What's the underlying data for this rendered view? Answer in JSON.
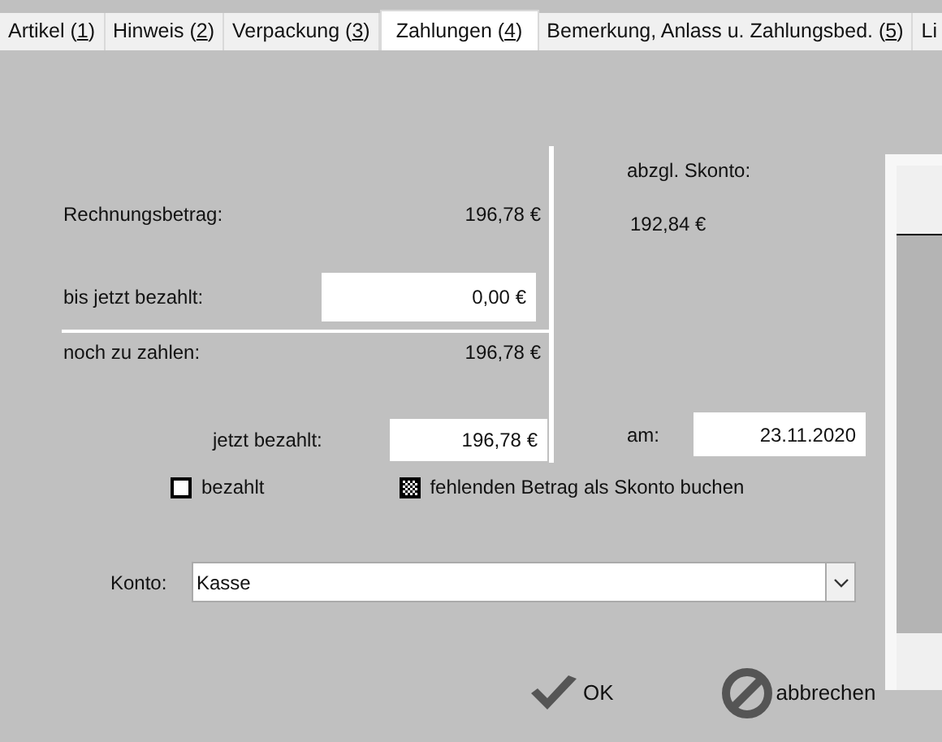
{
  "tabs": [
    {
      "label": "Artikel (",
      "hotkey": "1",
      "tail": ")",
      "selected": false
    },
    {
      "label": "Hinweis (",
      "hotkey": "2",
      "tail": ")",
      "selected": false
    },
    {
      "label": "Verpackung (",
      "hotkey": "3",
      "tail": ")",
      "selected": false
    },
    {
      "label": "Zahlungen (",
      "hotkey": "4",
      "tail": ")",
      "selected": true
    },
    {
      "label": "Bemerkung, Anlass u. Zahlungsbed. (",
      "hotkey": "5",
      "tail": ")",
      "selected": false
    },
    {
      "label": "Li",
      "selected": false
    }
  ],
  "payment": {
    "invoice_amount": {
      "label": "Rechnungsbetrag:",
      "value": "196,78 €"
    },
    "paid_so_far": {
      "label": "bis jetzt bezahlt:",
      "value": "0,00 €"
    },
    "remaining": {
      "label": "noch zu zahlen:",
      "value": "196,78 €"
    },
    "paid_now": {
      "label": "jetzt bezahlt:",
      "value": "196,78 €"
    },
    "discount": {
      "label": "abzgl. Skonto:",
      "value": "192,84 €"
    },
    "date": {
      "label": "am:",
      "value": "23.11.2020"
    }
  },
  "options": [
    {
      "label": "bezahlt",
      "checked": false
    },
    {
      "label": "fehlenden Betrag als Skonto buchen",
      "checked": true
    }
  ],
  "account": {
    "label": "Konto:",
    "value": "Kasse"
  },
  "buttons": [
    {
      "kind": "ok",
      "label": "OK"
    },
    {
      "kind": "cancel",
      "label": "abbrechen"
    }
  ]
}
